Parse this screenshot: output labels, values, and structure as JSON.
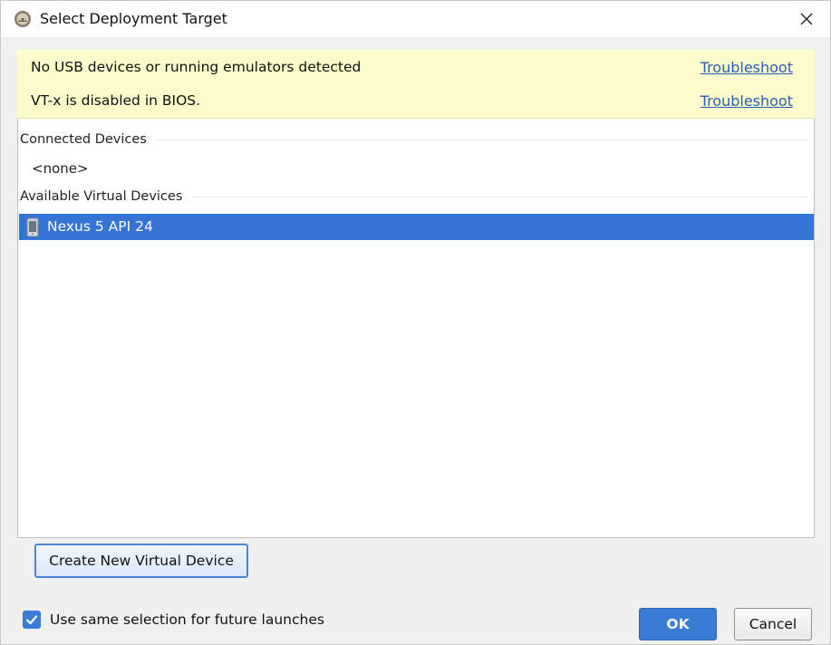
{
  "window": {
    "title": "Select Deployment Target",
    "app_icon": "android-studio-icon",
    "close_icon": "close-icon"
  },
  "warnings": [
    {
      "message": "No USB devices or running emulators detected",
      "link": "Troubleshoot"
    },
    {
      "message": "VT-x is disabled in BIOS.",
      "link": "Troubleshoot"
    }
  ],
  "connected_devices": {
    "header": "Connected Devices",
    "empty_text": "<none>"
  },
  "virtual_devices": {
    "header": "Available Virtual Devices",
    "items": [
      {
        "label": "Nexus 5 API 24",
        "icon": "phone-icon",
        "selected": true
      }
    ]
  },
  "create_button": {
    "label": "Create New Virtual Device"
  },
  "future_launches": {
    "label": "Use same selection for future launches",
    "checked": true
  },
  "buttons": {
    "ok": "OK",
    "cancel": "Cancel"
  },
  "colors": {
    "warning_bg": "#fcfccc",
    "selection_bg": "#3574d4",
    "link": "#2a5fb5",
    "primary_button": "#3a7bd5"
  }
}
